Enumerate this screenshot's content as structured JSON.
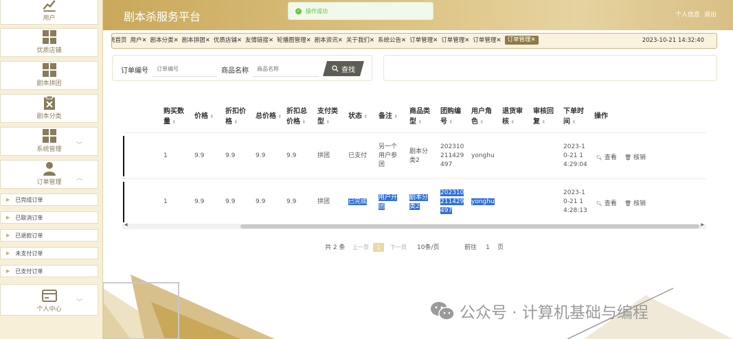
{
  "sidebar": {
    "items": [
      {
        "label": "用户",
        "icon": "chart-icon"
      },
      {
        "label": "优质店铺",
        "icon": "grid-icon"
      },
      {
        "label": "剧本拼团",
        "icon": "grid-icon"
      },
      {
        "label": "剧本分类",
        "icon": "clipboard-icon"
      },
      {
        "label": "系统管理",
        "icon": "grid-icon"
      },
      {
        "label": "订单管理",
        "icon": "user-icon"
      },
      {
        "label": "个人中心",
        "icon": "card-icon"
      }
    ],
    "sub_items": [
      "已完成订单",
      "已取消订单",
      "已退款订单",
      "未支付订单",
      "已支付订单"
    ]
  },
  "header": {
    "title": "剧本杀服务平台",
    "profile_link": "个人信息",
    "logout_link": "退出"
  },
  "toast": {
    "message": "操作成功"
  },
  "tabs": [
    "统首页",
    "用户✕",
    "剧本分类✕",
    "剧本拼团✕",
    "优质店铺✕",
    "友情链接✕",
    "轮播图管理✕",
    "剧本资讯✕",
    "关于我们✕",
    "系统公告✕",
    "订单管理✕",
    "订单管理✕",
    "订单管理✕",
    "订单管理✕"
  ],
  "datetime": "2023-10-21 14:32:40",
  "search": {
    "order_label": "订单编号",
    "order_placeholder": "订单编号",
    "product_label": "商品名称",
    "product_placeholder": "商品名称",
    "button": "查找"
  },
  "table": {
    "headers": [
      [
        "购买数",
        "量"
      ],
      [
        "价格"
      ],
      [
        "折扣价",
        "格"
      ],
      [
        "总价格"
      ],
      [
        "折扣总",
        "价格"
      ],
      [
        "支付类",
        "型"
      ],
      [
        "状态"
      ],
      [
        "备注"
      ],
      [
        "商品类",
        "型"
      ],
      [
        "团购编",
        "号"
      ],
      [
        "用户角",
        "色"
      ],
      [
        "退货审",
        "核"
      ],
      [
        "审核回",
        "复"
      ],
      [
        "下单时",
        "间"
      ],
      [
        "操作"
      ]
    ],
    "rows": [
      {
        "qty": "1",
        "price": "9.9",
        "discount_price": "9.9",
        "total": "9.9",
        "discount_total": "9.9",
        "pay_type": "拼团",
        "status": "已支付",
        "remark": [
          "另一个",
          "用户参",
          "团"
        ],
        "category": [
          "剧本分",
          "类2"
        ],
        "group_no": [
          "202310",
          "211429",
          "497"
        ],
        "user_role": "yonghu",
        "time": [
          "2023-1",
          "0-21 1",
          "4:29:04"
        ]
      },
      {
        "qty": "1",
        "price": "9.9",
        "discount_price": "9.9",
        "total": "9.9",
        "discount_total": "9.9",
        "pay_type": "拼团",
        "status": "已完成",
        "remark": [
          "用户开",
          "团"
        ],
        "category": [
          "剧本分",
          "类2"
        ],
        "group_no": [
          "202310",
          "211429",
          "497"
        ],
        "user_role": "yonghu",
        "time": [
          "2023-1",
          "0-21 1",
          "4:28:13"
        ]
      }
    ],
    "view_label": "查看",
    "verify_label": "核销"
  },
  "pagination": {
    "total": "共 2 条",
    "prev": "上一页",
    "page": "1",
    "next": "下一页",
    "size": "10条/页",
    "goto": "前往",
    "goto_value": "1",
    "page_unit": "页"
  },
  "watermark": "公众号 · 计算机基础与编程",
  "colors": {
    "gold": "#c9a85a",
    "sidebar_bg": "#f7efd8",
    "selection": "#2f6fdb",
    "success": "#67c23a"
  }
}
